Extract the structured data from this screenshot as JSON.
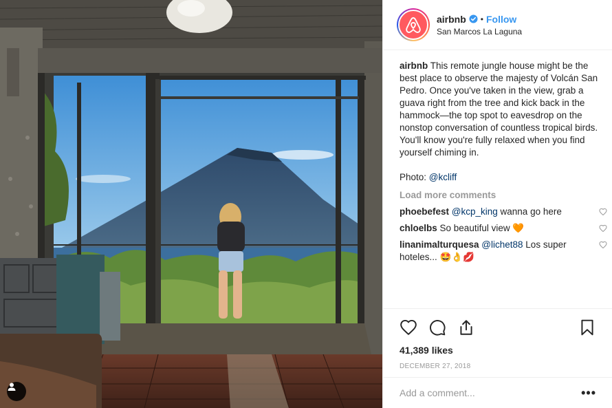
{
  "post": {
    "username": "airbnb",
    "follow_label": "Follow",
    "separator": "•",
    "location": "San Marcos La Laguna",
    "caption_user": "airbnb",
    "caption_text": "This remote jungle house might be the best place to observe the majesty of Volcán San Pedro. Once you've taken in the view, grab a guava right from the tree and kick back in the hammock—the top spot to eavesdrop on the nonstop conversation of countless tropical birds. You'll know you're fully relaxed when you find yourself chiming in.",
    "photo_prefix": "Photo: ",
    "photo_credit": "@kcliff",
    "load_more": "Load more comments",
    "likes": "41,389 likes",
    "date": "DECEMBER 27, 2018",
    "add_comment_placeholder": "Add a comment...",
    "more_glyph": "•••"
  },
  "comments": [
    {
      "user": "phoebefest",
      "mention": "@kcp_king",
      "text": " wanna go here",
      "emoji": ""
    },
    {
      "user": "chloelbs",
      "mention": "",
      "text": "So beautiful view ",
      "emoji": "🧡"
    },
    {
      "user": "linanimalturquesa",
      "mention": "@lichet88",
      "text": " Los super hoteles... ",
      "emoji": "🤩👌💋"
    }
  ],
  "colors": {
    "follow": "#3897f0",
    "brand": "#ff5a5f",
    "mention": "#003569",
    "muted": "#999999"
  },
  "icons": [
    "airbnb-logo-icon",
    "verified-badge-icon",
    "heart-icon",
    "comment-icon",
    "share-icon",
    "bookmark-icon",
    "user-tag-icon",
    "more-options-icon"
  ]
}
